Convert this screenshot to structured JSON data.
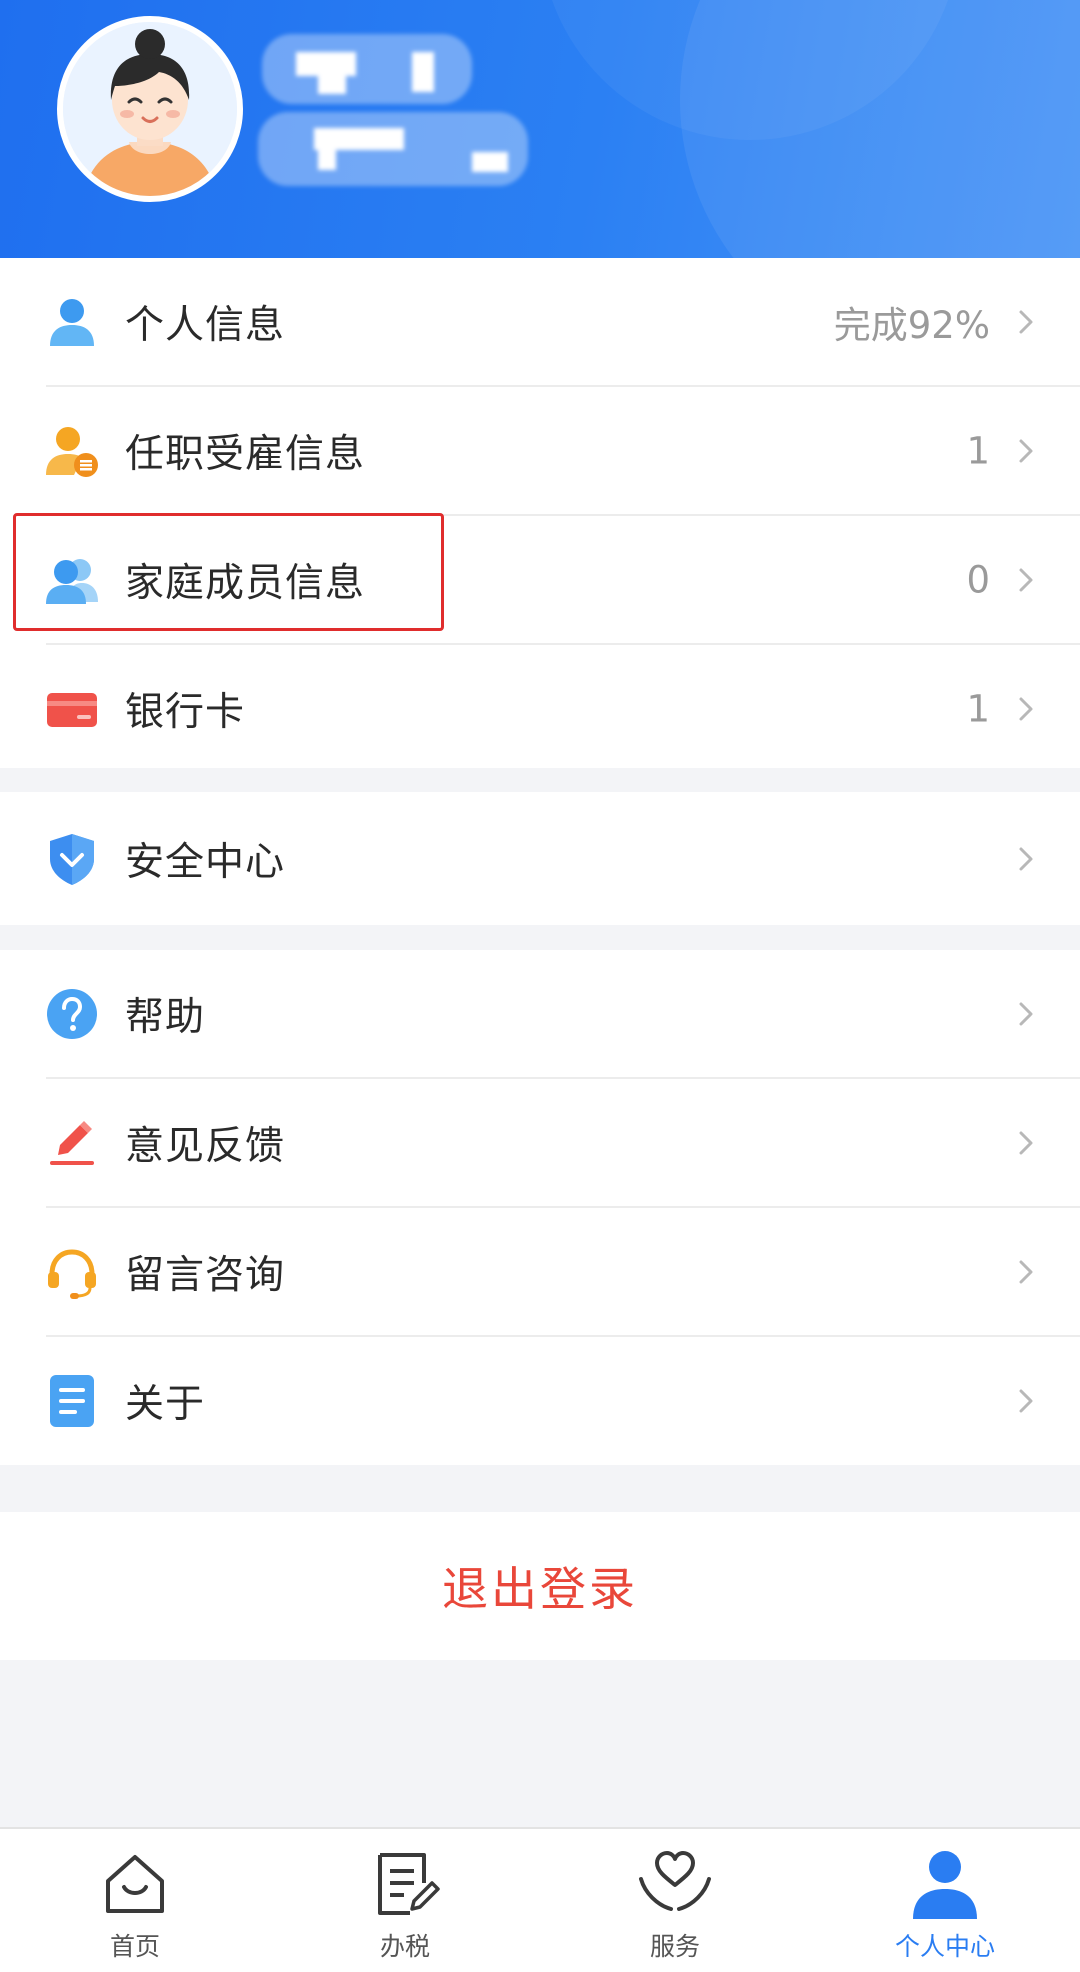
{
  "menu_group1": [
    {
      "label": "个人信息",
      "value": "完成92%"
    },
    {
      "label": "任职受雇信息",
      "value": "1"
    },
    {
      "label": "家庭成员信息",
      "value": "0"
    },
    {
      "label": "银行卡",
      "value": "1"
    }
  ],
  "menu_group2": [
    {
      "label": "安全中心",
      "value": ""
    }
  ],
  "menu_group3": [
    {
      "label": "帮助",
      "value": ""
    },
    {
      "label": "意见反馈",
      "value": ""
    },
    {
      "label": "留言咨询",
      "value": ""
    },
    {
      "label": "关于",
      "value": ""
    }
  ],
  "logout_label": "退出登录",
  "tabs": [
    {
      "label": "首页",
      "icon": "home-icon",
      "active": false
    },
    {
      "label": "办税",
      "icon": "tax-form-icon",
      "active": false
    },
    {
      "label": "服务",
      "icon": "heart-hands-icon",
      "active": false
    },
    {
      "label": "个人中心",
      "icon": "person-icon",
      "active": true
    }
  ],
  "colors": {
    "header_blue": "#2b80f3",
    "logout_red": "#e9473a",
    "active_tab": "#2a7df2",
    "highlight_red": "#e02d2d"
  }
}
